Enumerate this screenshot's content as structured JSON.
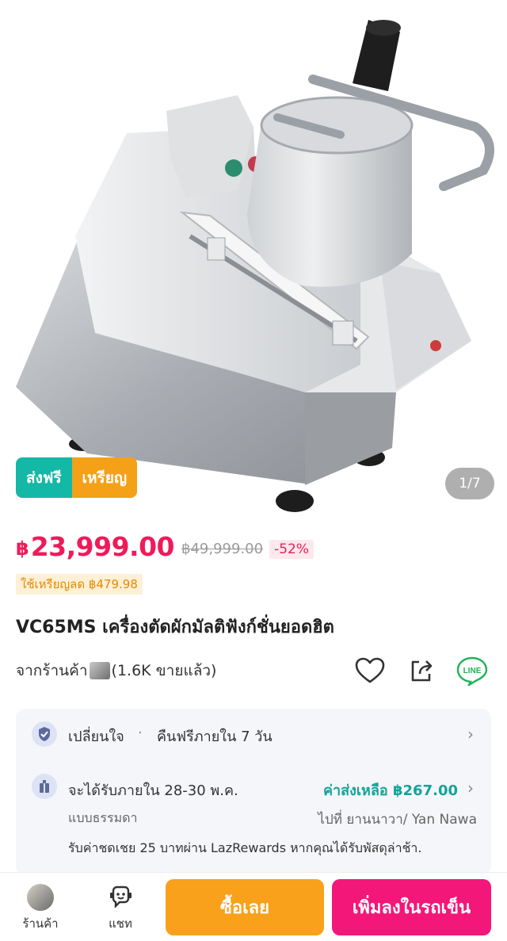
{
  "product": {
    "image_counter": "1/7",
    "badge_free": "ส่งฟรี",
    "badge_coin": "เหรียญ",
    "currency": "฿",
    "price": "23,999.00",
    "old_price": "฿49,999.00",
    "discount": "-52%",
    "coin_discount": "ใช้เหรียญลด ฿479.98",
    "title": "VC65MS เครื่องตัดผักมัลติฟังก์ชั่นยอดฮิต"
  },
  "shop": {
    "prefix": "จากร้านค้า",
    "sold": "(1.6K ขายแล้ว)"
  },
  "actions": {
    "line_label": "LINE"
  },
  "service": {
    "return_label": "เปลี่ยนใจ",
    "return_sep": "·",
    "return_text": "คืนฟรีภายใน 7 วัน",
    "delivery_label": "จะได้รับภายใน 28-30 พ.ค.",
    "delivery_type": "แบบธรรมดา",
    "ship_fee": "ค่าส่งเหลือ ฿267.00",
    "destination": "ไปที่ ยานนาวา/ Yan Nawa",
    "compensation": "รับค่าชดเชย 25 บาทผ่าน LazRewards หากคุณได้รับพัสดุล่าช้า.",
    "chevron": "›"
  },
  "bottom": {
    "shop_tab": "ร้านค้า",
    "chat_tab": "แชท",
    "buy_now": "ซื้อเลย",
    "add_to_cart": "เพิ่มลงในรถเข็น"
  },
  "colors": {
    "price": "#ee1b5a",
    "free_shipping": "#14b8a6",
    "coin": "#f5a118",
    "buy_now": "#f9a11b",
    "add_to_cart": "#f3177a",
    "ship_fee": "#14a39a"
  }
}
